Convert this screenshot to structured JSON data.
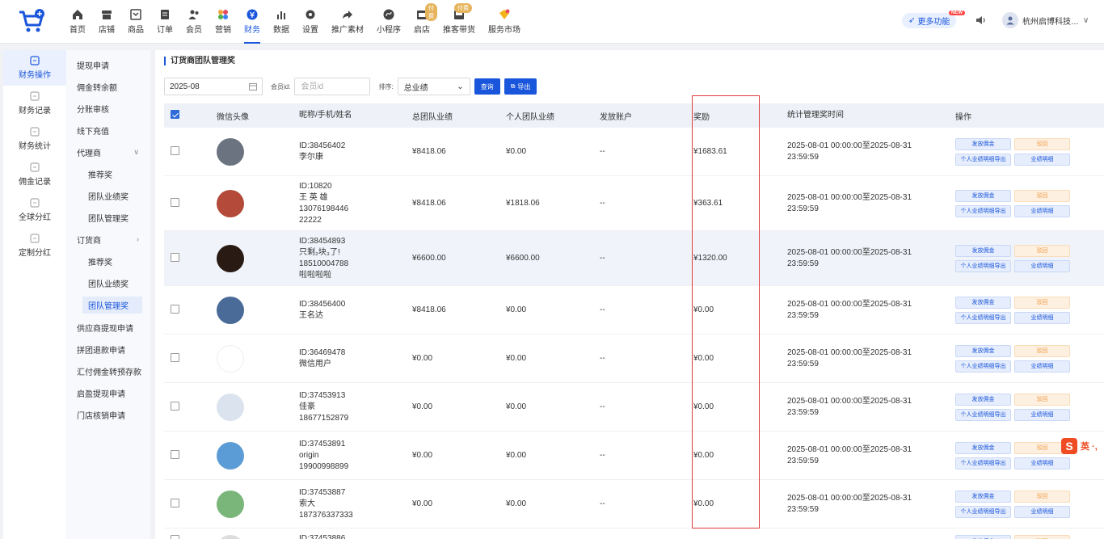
{
  "nav": {
    "items": [
      {
        "label": "首页",
        "icon": "home-icon",
        "badge": ""
      },
      {
        "label": "店铺",
        "icon": "store-icon",
        "badge": ""
      },
      {
        "label": "商品",
        "icon": "goods-icon",
        "badge": ""
      },
      {
        "label": "订单",
        "icon": "order-icon",
        "badge": ""
      },
      {
        "label": "会员",
        "icon": "member-icon",
        "badge": ""
      },
      {
        "label": "营销",
        "icon": "marketing-icon",
        "badge": ""
      },
      {
        "label": "财务",
        "icon": "finance-icon",
        "badge": "",
        "active": true
      },
      {
        "label": "数据",
        "icon": "data-icon",
        "badge": ""
      },
      {
        "label": "设置",
        "icon": "settings-icon",
        "badge": ""
      },
      {
        "label": "推广素材",
        "icon": "share-icon",
        "badge": ""
      },
      {
        "label": "小程序",
        "icon": "miniprogram-icon",
        "badge": ""
      },
      {
        "label": "启店",
        "icon": "open-store-icon",
        "badge": "付费"
      },
      {
        "label": "推客带货",
        "icon": "promoter-icon",
        "badge": "付费"
      },
      {
        "label": "服务市场",
        "icon": "service-icon",
        "badge": ""
      }
    ],
    "more_label": "更多功能",
    "new_badge": "NEW",
    "user_name": "杭州启博科技…"
  },
  "rail": {
    "items": [
      {
        "label": "财务操作",
        "active": true
      },
      {
        "label": "财务记录"
      },
      {
        "label": "财务统计"
      },
      {
        "label": "佣金记录"
      },
      {
        "label": "全球分红"
      },
      {
        "label": "定制分红"
      }
    ]
  },
  "submenu": {
    "items": [
      {
        "label": "提现申请",
        "level": 1
      },
      {
        "label": "佣金转余额",
        "level": 1
      },
      {
        "label": "分账审核",
        "level": 1
      },
      {
        "label": "线下充值",
        "level": 1
      },
      {
        "label": "代理商",
        "level": 1,
        "caret": "∨"
      },
      {
        "label": "推荐奖",
        "level": 2
      },
      {
        "label": "团队业绩奖",
        "level": 2
      },
      {
        "label": "团队管理奖",
        "level": 2
      },
      {
        "label": "订货商",
        "level": 1,
        "caret": "›"
      },
      {
        "label": "推荐奖",
        "level": 2
      },
      {
        "label": "团队业绩奖",
        "level": 2
      },
      {
        "label": "团队管理奖",
        "level": 2,
        "active": true
      },
      {
        "label": "供应商提现申请",
        "level": 1
      },
      {
        "label": "拼团退款申请",
        "level": 1
      },
      {
        "label": "汇付佣金转预存款",
        "level": 1
      },
      {
        "label": "启盈提现申请",
        "level": 1
      },
      {
        "label": "门店核销申请",
        "level": 1
      }
    ]
  },
  "page": {
    "title": "订货商团队管理奖",
    "filter": {
      "date_value": "2025-08",
      "member_label": "会员id:",
      "member_placeholder": "会员id",
      "sort_label": "排序:",
      "sort_value": "总业绩",
      "query_button": "查询",
      "export_button": "导出"
    }
  },
  "table": {
    "headers": [
      "微信头像",
      "昵称/手机/姓名",
      "总团队业绩",
      "个人团队业绩",
      "发放账户",
      "奖励",
      "统计管理奖时间",
      "操作"
    ],
    "ops": {
      "pay": "发放佣金",
      "reject": "驳回",
      "export_detail": "个人业绩明细导出",
      "detail": "业绩明细"
    },
    "rows": [
      {
        "lines": [
          "ID:38456402",
          "李尔康"
        ],
        "total": "¥8418.06",
        "personal": "¥0.00",
        "account": "--",
        "reward": "¥1683.61",
        "time1": "2025-08-01 00:00:00至2025-08-31",
        "time2": "23:59:59",
        "avatar_color": "#6b7380"
      },
      {
        "lines": [
          "ID:10820",
          "王 英 雄",
          "13076198446",
          "22222"
        ],
        "total": "¥8418.06",
        "personal": "¥1818.06",
        "account": "--",
        "reward": "¥363.61",
        "time1": "2025-08-01 00:00:00至2025-08-31",
        "time2": "23:59:59",
        "avatar_color": "#b34a3a"
      },
      {
        "lines": [
          "ID:38454893",
          "只剩₂块₃了!",
          "18510004788",
          "啦啦啦啦"
        ],
        "total": "¥6600.00",
        "personal": "¥6600.00",
        "account": "--",
        "reward": "¥1320.00",
        "time1": "2025-08-01 00:00:00至2025-08-31",
        "time2": "23:59:59",
        "avatar_color": "#2a1a14",
        "highlight": true
      },
      {
        "lines": [
          "ID:38456400",
          "王名达"
        ],
        "total": "¥8418.06",
        "personal": "¥0.00",
        "account": "--",
        "reward": "¥0.00",
        "time1": "2025-08-01 00:00:00至2025-08-31",
        "time2": "23:59:59",
        "avatar_color": "#4a6a98"
      },
      {
        "lines": [
          "ID:36469478",
          "微信用户"
        ],
        "total": "¥0.00",
        "personal": "¥0.00",
        "account": "--",
        "reward": "¥0.00",
        "time1": "2025-08-01 00:00:00至2025-08-31",
        "time2": "23:59:59",
        "avatar_color": "#ffffff"
      },
      {
        "lines": [
          "ID:37453913",
          "佳豪",
          "18677152879"
        ],
        "total": "¥0.00",
        "personal": "¥0.00",
        "account": "--",
        "reward": "¥0.00",
        "time1": "2025-08-01 00:00:00至2025-08-31",
        "time2": "23:59:59",
        "avatar_color": "#dbe4ee"
      },
      {
        "lines": [
          "ID:37453891",
          "origin",
          "19900998899"
        ],
        "total": "¥0.00",
        "personal": "¥0.00",
        "account": "--",
        "reward": "¥0.00",
        "time1": "2025-08-01 00:00:00至2025-08-31",
        "time2": "23:59:59",
        "avatar_color": "#5c9cd6"
      },
      {
        "lines": [
          "ID:37453887",
          "索大",
          "187376337333"
        ],
        "total": "¥0.00",
        "personal": "¥0.00",
        "account": "--",
        "reward": "¥0.00",
        "time1": "2025-08-01 00:00:00至2025-08-31",
        "time2": "23:59:59",
        "avatar_color": "#7ab57a"
      },
      {
        "lines": [
          "ID:37453886"
        ],
        "total": "",
        "personal": "",
        "account": "",
        "reward": "",
        "time1": "",
        "time2": "",
        "avatar_color": "#dddddd",
        "partial": true
      }
    ]
  },
  "ime": {
    "logo": "S",
    "text": "英 ·,"
  },
  "colors": {
    "accent": "#1a56db",
    "highlight_box": "#e03b3b",
    "reject": "#f0a050"
  }
}
